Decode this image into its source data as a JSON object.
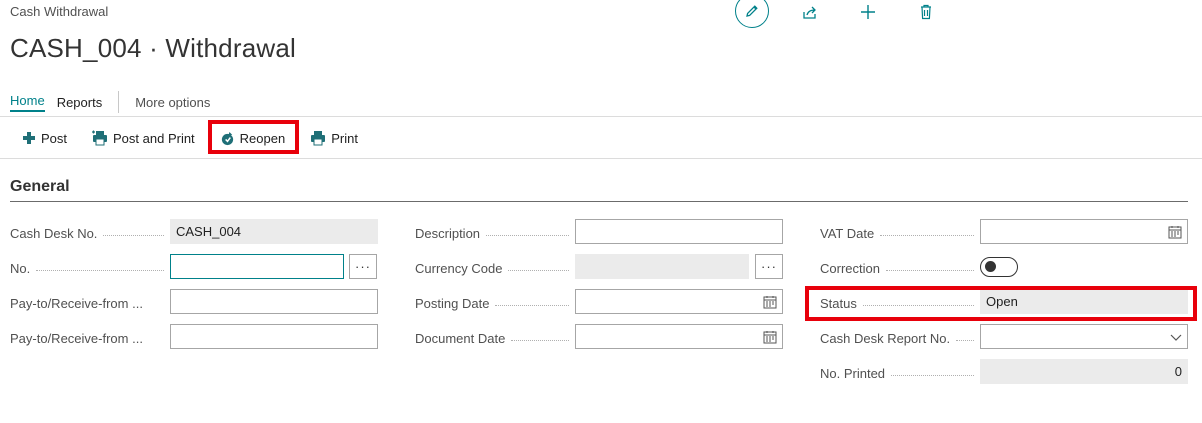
{
  "header": {
    "breadcrumb": "Cash Withdrawal",
    "title": "CASH_004 · Withdrawal",
    "icons": [
      "pencil-icon",
      "share-icon",
      "plus-icon",
      "trash-icon"
    ]
  },
  "tabs": [
    {
      "label": "Home",
      "active": true
    },
    {
      "label": "Reports",
      "active": false
    },
    {
      "label": "More options",
      "active": false
    }
  ],
  "actions": [
    {
      "label": "Post",
      "icon": "post-icon"
    },
    {
      "label": "Post and Print",
      "icon": "post-print-icon"
    },
    {
      "label": "Reopen",
      "icon": "reopen-icon",
      "highlighted": true
    },
    {
      "label": "Print",
      "icon": "printer-icon"
    }
  ],
  "section": {
    "title": "General"
  },
  "fields": {
    "cash_desk_no": {
      "label": "Cash Desk No.",
      "value": "CASH_004"
    },
    "no": {
      "label": "No.",
      "value": ""
    },
    "pay_to_1": {
      "label": "Pay-to/Receive-from ...",
      "value": ""
    },
    "pay_to_2": {
      "label": "Pay-to/Receive-from ...",
      "value": ""
    },
    "description": {
      "label": "Description",
      "value": ""
    },
    "currency_code": {
      "label": "Currency Code",
      "value": ""
    },
    "posting_date": {
      "label": "Posting Date",
      "value": ""
    },
    "document_date": {
      "label": "Document Date",
      "value": ""
    },
    "vat_date": {
      "label": "VAT Date",
      "value": ""
    },
    "correction": {
      "label": "Correction",
      "value": false
    },
    "status": {
      "label": "Status",
      "value": "Open",
      "highlighted": true
    },
    "cash_desk_report_no": {
      "label": "Cash Desk Report No.",
      "value": ""
    },
    "no_printed": {
      "label": "No. Printed",
      "value": "0"
    }
  },
  "colors": {
    "accent": "#00818a",
    "highlight": "#e8000b"
  }
}
